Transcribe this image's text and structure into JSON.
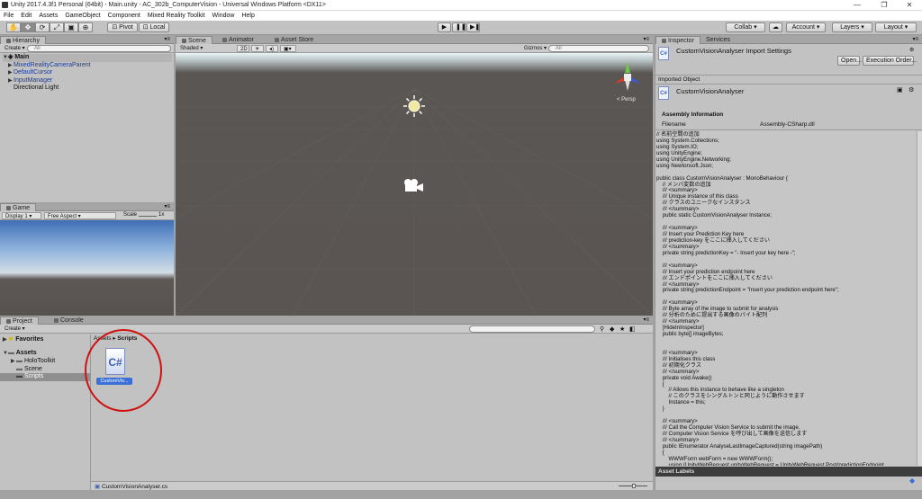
{
  "window": {
    "title": "Unity 2017.4.3f1 Personal (64bit) - Main.unity - AC_302b_ComputerVision - Universal Windows Platform <DX11>"
  },
  "menu": [
    "File",
    "Edit",
    "Assets",
    "GameObject",
    "Component",
    "Mixed Reality Toolkit",
    "Window",
    "Help"
  ],
  "toolbar": {
    "pivot": "Pivot",
    "local": "Local",
    "collab": "Collab ▾",
    "account": "Account",
    "layers": "Layers",
    "layout": "Layout"
  },
  "hierarchy": {
    "tab": "Hierarchy",
    "create": "Create ▾",
    "search_placeholder": "All",
    "scene": "Main",
    "items": [
      "MixedRealityCameraParent",
      "DefaultCursor",
      "InputManager",
      "Directional Light"
    ]
  },
  "scene_panel": {
    "tabs": [
      "Scene",
      "Animator",
      "Asset Store"
    ],
    "shading": "Shaded",
    "mode2d": "2D",
    "gizmos": "Gizmos ▾",
    "search_placeholder": "All",
    "persp": "< Persp"
  },
  "game_panel": {
    "tab": "Game",
    "display": "Display 1",
    "aspect": "Free Aspect",
    "scale_label": "Scale",
    "scale_value": "1x"
  },
  "project_panel": {
    "tabs": [
      "Project",
      "Console"
    ],
    "create": "Create ▾",
    "favorites": "Favorites",
    "assets": "Assets",
    "folders": [
      "HoloToolkit",
      "Scene",
      "Scripts"
    ],
    "breadcrumb_root": "Assets",
    "breadcrumb_leaf": "Scripts",
    "file_label": "CustomVis...",
    "file_glyph": "C#",
    "status_path": "CustomVisionAnalyser.cs"
  },
  "inspector": {
    "tabs": [
      "Inspector",
      "Services"
    ],
    "import_title": "CustomVisionAnalyser Import Settings",
    "open_button": "Open...",
    "exec_order_button": "Execution Order...",
    "imported_object": "Imported Object",
    "object_name": "CustomVisionAnalyser",
    "assembly_header": "Assembly Information",
    "filename_label": "Filename",
    "filename_value": "Assembly-CSharp.dll",
    "code_lines": [
      "// 名前空間の追加",
      "using System.Collections;",
      "using System.IO;",
      "using UnityEngine;",
      "using UnityEngine.Networking;",
      "using Newtonsoft.Json;",
      "",
      "public class CustomVisionAnalyser : MonoBehaviour {",
      "    // メンバ変数の追加",
      "    /// <summary>",
      "    /// Unique instance of this class",
      "    /// クラスのユニークなインスタンス",
      "    /// </summary>",
      "    public static CustomVisionAnalyser Instance;",
      "",
      "    /// <summary>",
      "    /// Insert your Prediction Key here",
      "    /// prediction-key をここに挿入してください",
      "    /// </summary>",
      "    private string predictionKey = \"- Insert your key here -\";",
      "",
      "    /// <summary>",
      "    /// Insert your prediction endpoint here",
      "    /// エンドポイントをここに挿入してください",
      "    /// </summary>",
      "    private string predictionEndpoint = \"Insert your prediction endpoint here\";",
      "",
      "    /// <summary>",
      "    /// Byte array of the image to submit for analysis",
      "    /// 分析のために提出する画像のバイト配列",
      "    /// </summary>",
      "    [HideInInspector]",
      "    public byte[] imageBytes;",
      "",
      "",
      "    /// <summary>",
      "    /// Initialises this class",
      "    /// 初期化クラス",
      "    /// </summary>",
      "    private void Awake()",
      "    {",
      "        // Allows this instance to behave like a singleton",
      "        // このクラスをシングルトンと同じように動作させます",
      "        Instance = this;",
      "    }",
      "",
      "    /// <summary>",
      "    /// Call the Computer Vision Service to submit the image.",
      "    /// Computer Vision Service を呼び出して画像を送信します",
      "    /// </summary>",
      "    public IEnumerator AnalyseLastImageCaptured(string imagePath)",
      "    {",
      "        WWWForm webForm = new WWWForm();",
      "        using (UnityWebRequest unityWebRequest = UnityWebRequest.Post(predictionEndpoint"
    ],
    "asset_labels": "Asset Labels"
  },
  "colors": {
    "panel": "#c2c2c2",
    "selection": "#8f8f8f",
    "prefab_text": "#1a3a9c",
    "annotation": "#d01010"
  }
}
